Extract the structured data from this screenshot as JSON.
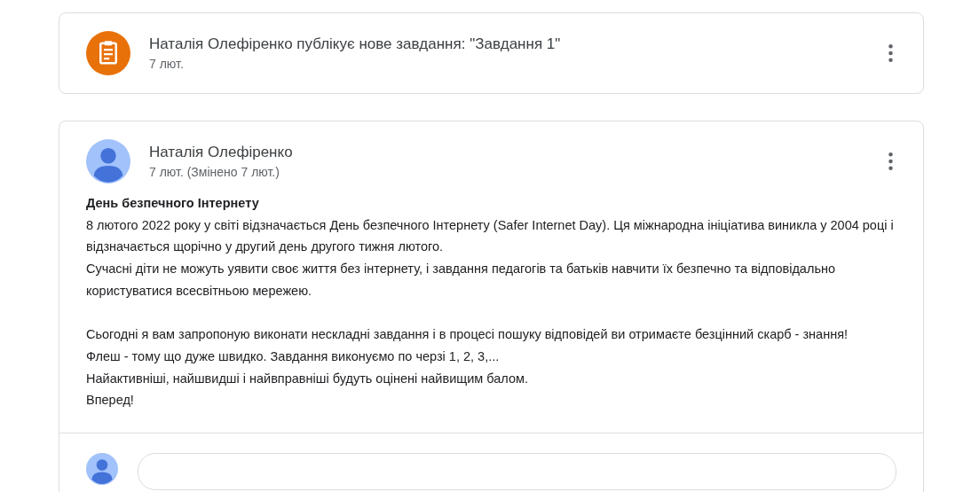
{
  "posts": [
    {
      "kind": "assignment",
      "title": "Наталія Олефіренко публікує нове завдання: \"Завдання 1\"",
      "date": "7 лют."
    },
    {
      "kind": "announcement",
      "author": "Наталія Олефіренко",
      "date": "7 лют. (Змінено 7 лют.)",
      "body": [
        {
          "kind": "heading",
          "text": "День безпечного Інтернету",
          "space_before": false
        },
        {
          "kind": "text",
          "text": "8 лютого 2022 року у світі відзначається День безпечного Інтернету (Safer Internet Day). Ця міжнародна ініціатива виникла у 2004 році і відзначається щорічно у другий день другого тижня лютого.",
          "space_before": false
        },
        {
          "kind": "text",
          "text": "Сучасні діти не можуть уявити своє життя без інтернету, і завдання педагогів та батьків навчити їх безпечно та відповідально користуватися всесвітньою мережею.",
          "space_before": false
        },
        {
          "kind": "text",
          "text": "Сьогодні я вам запропоную виконати нескладні завдання і в процесі пошуку відповідей ви отримаєте безцінний скарб - знання!",
          "space_before": true
        },
        {
          "kind": "text",
          "text": "Флеш - тому що дуже швидко. Завдання виконуємо по черзі 1, 2, 3,...",
          "space_before": false
        },
        {
          "kind": "text",
          "text": "Найактивніші, найшвидші і найвправніші будуть оцінені найвищим балом.",
          "space_before": false
        },
        {
          "kind": "text",
          "text": "Вперед!",
          "space_before": false
        }
      ]
    }
  ]
}
